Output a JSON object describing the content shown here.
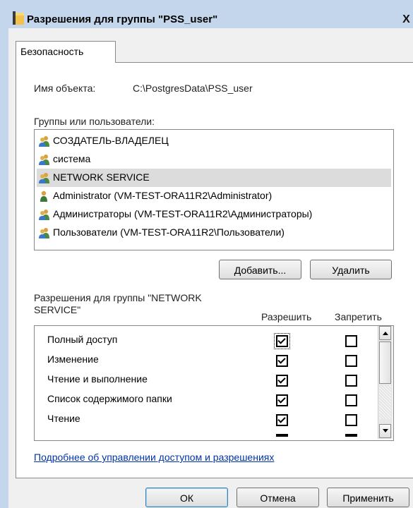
{
  "window": {
    "title": "Разрешения для группы \"PSS_user\"",
    "close_glyph": "X"
  },
  "tabs": [
    {
      "label": "Безопасность"
    }
  ],
  "object": {
    "label": "Имя объекта:",
    "value": "C:\\PostgresData\\PSS_user"
  },
  "groups": {
    "label": "Группы или пользователи:",
    "items": [
      {
        "label": "СОЗДАТЕЛЬ-ВЛАДЕЛЕЦ",
        "icon": "users-group-icon"
      },
      {
        "label": "система",
        "icon": "users-group-icon"
      },
      {
        "label": "NETWORK SERVICE",
        "icon": "users-group-icon",
        "selected": true
      },
      {
        "label": "Administrator (VM-TEST-ORA11R2\\Administrator)",
        "icon": "user-icon"
      },
      {
        "label": "Администраторы (VM-TEST-ORA11R2\\Администраторы)",
        "icon": "users-group-icon"
      },
      {
        "label": "Пользователи (VM-TEST-ORA11R2\\Пользователи)",
        "icon": "users-group-icon"
      }
    ]
  },
  "buttons": {
    "add": "Добавить...",
    "remove": "Удалить",
    "ok": "ОК",
    "cancel": "Отмена",
    "apply": "Применить"
  },
  "permissions": {
    "label_line1": "Разрешения для группы \"NETWORK",
    "label_line2": "SERVICE\"",
    "allow_header": "Разрешить",
    "deny_header": "Запретить",
    "rows": [
      {
        "name": "Полный доступ",
        "allow": true,
        "deny": false
      },
      {
        "name": "Изменение",
        "allow": true,
        "deny": false
      },
      {
        "name": "Чтение и выполнение",
        "allow": true,
        "deny": false
      },
      {
        "name": "Список содержимого папки",
        "allow": true,
        "deny": false
      },
      {
        "name": "Чтение",
        "allow": true,
        "deny": false
      }
    ]
  },
  "link": "Подробнее об управлении доступом и разрешениях"
}
